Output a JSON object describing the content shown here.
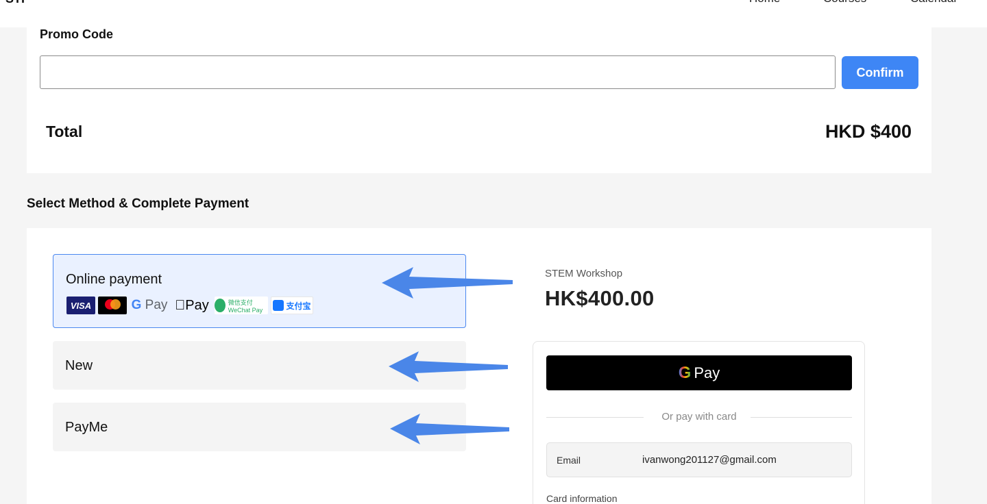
{
  "nav": {
    "logo": "STI",
    "links": [
      "Home",
      "Courses",
      "Calendar"
    ]
  },
  "promo": {
    "title": "Promo Code",
    "input_value": "",
    "confirm_label": "Confirm"
  },
  "total": {
    "label": "Total",
    "value": "HKD $400"
  },
  "payment": {
    "section_title": "Select Method & Complete Payment",
    "methods": [
      {
        "label": "Online payment",
        "selected": true
      },
      {
        "label": "New",
        "selected": false
      },
      {
        "label": "PayMe",
        "selected": false
      }
    ],
    "logos": {
      "visa": "VISA",
      "gpay": "Pay",
      "apay": "Pay",
      "wechat": "微信支付 WeChat Pay",
      "alipay": "支付宝"
    }
  },
  "checkout": {
    "product_name": "STEM Workshop",
    "price": "HK$400.00",
    "gpay_label": "Pay",
    "divider_text": "Or pay with card",
    "email_label": "Email",
    "email_value": "ivanwong201127@gmail.com",
    "card_info_label": "Card information"
  },
  "colors": {
    "accent": "#3e86f5",
    "arrow": "#4a86e8",
    "selected_bg": "#eaf1ff"
  },
  "icons": [
    "visa-icon",
    "mastercard-icon",
    "google-pay-icon",
    "apple-pay-icon",
    "wechat-pay-icon",
    "alipay-icon",
    "arrow-left-icon"
  ]
}
